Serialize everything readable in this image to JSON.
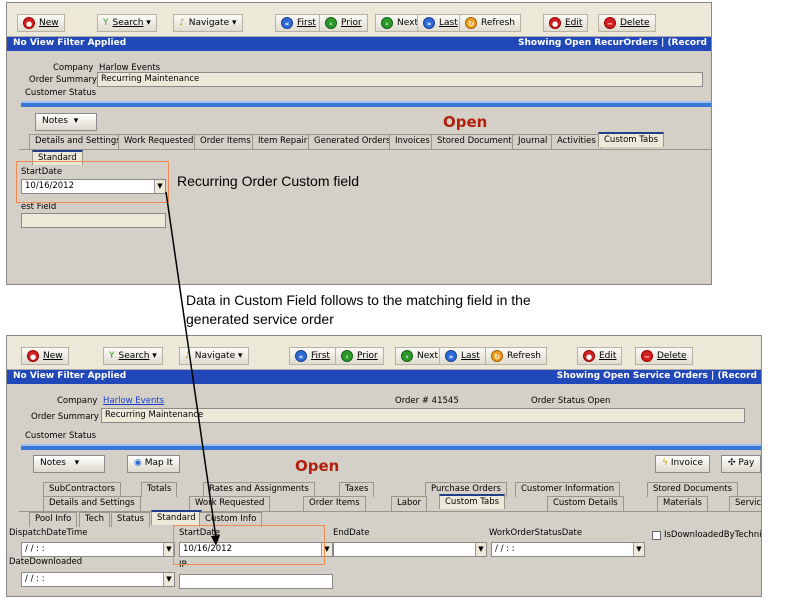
{
  "toolbar": {
    "new": "New",
    "search": "Search",
    "navigate": "Navigate",
    "first": "First",
    "prior": "Prior",
    "next": "Next",
    "last": "Last",
    "refresh": "Refresh",
    "edit": "Edit",
    "delete": "Delete"
  },
  "top": {
    "filter": "No View Filter Applied",
    "showing": "Showing Open RecurOrders  |  (Record",
    "company_label": "Company",
    "company_value": "Harlow Events",
    "summary_label": "Order Summary",
    "summary_value": "Recurring Maintenance",
    "status_label": "Customer Status",
    "notes": "Notes",
    "open": "Open",
    "tabs": [
      "Details and Settings",
      "Work Requested",
      "Order Items",
      "Item Repair",
      "Generated Orders",
      "Invoices",
      "Stored Documents",
      "Journal",
      "Activities",
      "Custom Tabs"
    ],
    "subtab": "Standard",
    "startdate_label": "StartDate",
    "startdate_value": "10/16/2012",
    "testfield_label": "est Field"
  },
  "annotations": {
    "a1": "Recurring Order Custom field",
    "a2": "Data in Custom Field follows to the matching field in the",
    "a3": "generated service order"
  },
  "bottom": {
    "filter": "No View Filter Applied",
    "showing": "Showing Open Service Orders  |  (Record",
    "company_label": "Company",
    "company_value": "Harlow Events",
    "order_no": "Order #  41545",
    "order_status": "Order Status  Open",
    "summary_label": "Order Summary",
    "summary_value": "Recurring Maintenance",
    "status_label": "Customer Status",
    "notes": "Notes",
    "mapit": "Map It",
    "open": "Open",
    "invoice": "Invoice",
    "pay": "Pay",
    "tabs_row1": [
      "SubContractors",
      "Totals",
      "Rates and Assignments",
      "Taxes",
      "Purchase Orders",
      "Customer Information",
      "Stored Documents"
    ],
    "tabs_row2": [
      "Details and Settings",
      "Work Requested",
      "Order Items",
      "Labor",
      "Custom Tabs",
      "Custom Details",
      "Materials",
      "Servic"
    ],
    "subtabs": [
      "Pool Info",
      "Tech",
      "Status",
      "Standard",
      "Custom Info"
    ],
    "dispatch_label": "DispatchDateTime",
    "dispatch_value": "/ /     : :",
    "startdate_label": "StartDate",
    "startdate_value": "10/16/2012",
    "enddate_label": "EndDate",
    "wosd_label": "WorkOrderStatusDate",
    "wosd_value": "/ /     : :",
    "isdl_label": "IsDownloadedByTechnicia",
    "datedl_label": "DateDownloaded",
    "datedl_value": "/ /     : :",
    "ip_label": "IP"
  }
}
